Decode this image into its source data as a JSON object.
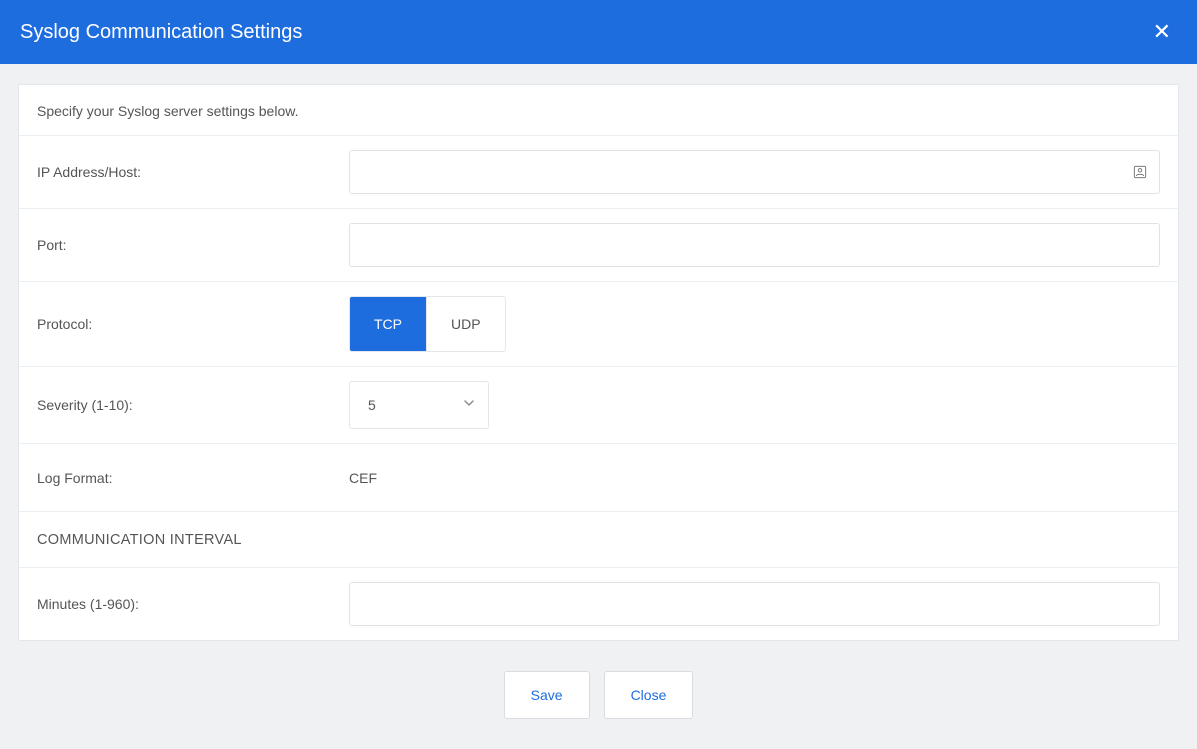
{
  "header": {
    "title": "Syslog Communication Settings"
  },
  "panel": {
    "instruction": "Specify your Syslog server settings below.",
    "fields": {
      "ip_label": "IP Address/Host:",
      "ip_value": "",
      "port_label": "Port:",
      "port_value": "",
      "protocol_label": "Protocol:",
      "protocol_tcp": "TCP",
      "protocol_udp": "UDP",
      "protocol_selected": "TCP",
      "severity_label": "Severity (1-10):",
      "severity_value": "5",
      "logformat_label": "Log Format:",
      "logformat_value": "CEF",
      "section_title": "COMMUNICATION INTERVAL",
      "minutes_label": "Minutes (1-960):",
      "minutes_value": ""
    }
  },
  "footer": {
    "save": "Save",
    "close": "Close"
  }
}
